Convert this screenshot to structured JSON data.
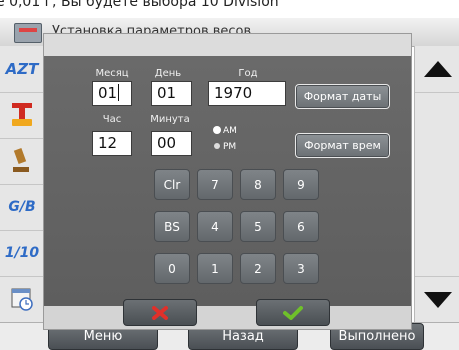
{
  "top_caption": "е 0,01 г, Вы будете выбора 10 Division",
  "window": {
    "title": "Установка параметров весов"
  },
  "sidebar": {
    "items": [
      {
        "label": "AZT",
        "icon": "azt-icon",
        "color": "#2e6bc6"
      },
      {
        "label": "",
        "icon": "tare-auto-icon"
      },
      {
        "label": "",
        "icon": "gavel-icon"
      },
      {
        "label": "G/B",
        "icon": "gross-net-icon",
        "color": "#2e6bc6"
      },
      {
        "label": "1/10",
        "icon": "division-icon",
        "color": "#2e6bc6"
      },
      {
        "label": "",
        "icon": "calendar-clock-icon"
      }
    ]
  },
  "scroll": {
    "up_icon": "arrow-up-icon",
    "down_icon": "arrow-down-icon"
  },
  "bottom_bar": {
    "menu": "Меню",
    "back": "Назад",
    "done": "Выполнено"
  },
  "dialog": {
    "labels": {
      "month": "Месяц",
      "day": "День",
      "year": "Год",
      "hour": "Час",
      "minute": "Минута"
    },
    "values": {
      "month": "01",
      "day": "01",
      "year": "1970",
      "hour": "12",
      "minute": "00"
    },
    "ampm": {
      "am": "AM",
      "pm": "PM",
      "selected": "AM"
    },
    "buttons": {
      "date_format": "Формат даты",
      "time_format": "Формат врем"
    },
    "keypad": [
      [
        "Clr",
        "7",
        "8",
        "9"
      ],
      [
        "BS",
        "4",
        "5",
        "6"
      ],
      [
        "0",
        "1",
        "2",
        "3"
      ]
    ],
    "cancel_icon": "x-icon",
    "confirm_icon": "check-icon"
  }
}
